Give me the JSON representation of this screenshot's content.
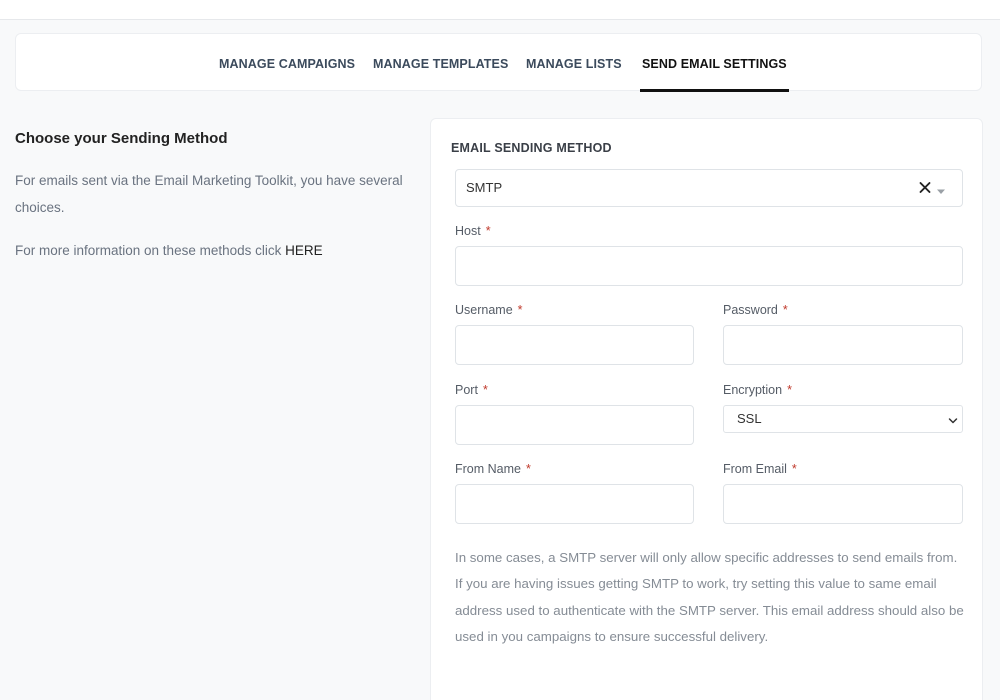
{
  "tabs": [
    {
      "label": "MANAGE CAMPAIGNS",
      "active": false
    },
    {
      "label": "MANAGE TEMPLATES",
      "active": false
    },
    {
      "label": "MANAGE LISTS",
      "active": false
    },
    {
      "label": "SEND EMAIL SETTINGS",
      "active": true
    }
  ],
  "left": {
    "title": "Choose your Sending Method",
    "description": "For emails sent via the Email Marketing Toolkit, you have several choices.",
    "more_text": "For more information on these methods click ",
    "more_link": "HERE"
  },
  "form": {
    "section_title": "EMAIL SENDING METHOD",
    "method": {
      "value": "SMTP",
      "clear_icon": "close-icon",
      "caret_icon": "caret-down-icon"
    },
    "required_mark": "*",
    "host": {
      "label": "Host",
      "value": ""
    },
    "username": {
      "label": "Username",
      "value": ""
    },
    "password": {
      "label": "Password",
      "value": ""
    },
    "port": {
      "label": "Port",
      "value": ""
    },
    "encryption": {
      "label": "Encryption",
      "value": "SSL",
      "icon": "chevron-down-icon"
    },
    "from_name": {
      "label": "From Name",
      "value": ""
    },
    "from_email": {
      "label": "From Email",
      "value": ""
    },
    "note": "In some cases, a SMTP server will only allow specific addresses to send emails from. If you are having issues getting SMTP to work, try setting this value to same email address used to authenticate with the SMTP server. This email address should also be used in you campaigns to ensure successful delivery."
  }
}
